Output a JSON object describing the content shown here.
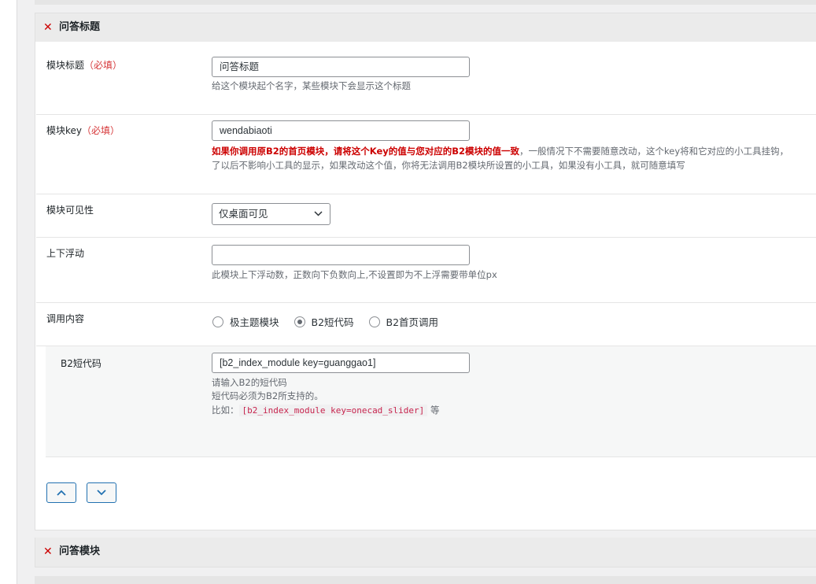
{
  "section1": {
    "title": "问答标题"
  },
  "fields": {
    "module_title": {
      "label": "模块标题",
      "required": "（必填）",
      "value": "问答标题",
      "desc": "给这个模块起个名字，某些模块下会显示这个标题"
    },
    "module_key": {
      "label": "模块key",
      "required": "（必填）",
      "value": "wendabiaoti",
      "desc_warning": "如果你调用原B2的首页模块，请将这个Key的值与您对应的B2模块的值一致",
      "desc_rest": "，一般情况下不需要随意改动，这个key将和它对应的小工具挂钩，",
      "desc_line2": "了以后不影响小工具的显示，如果改动这个值，你将无法调用B2模块所设置的小工具，如果没有小工具，就可随意填写"
    },
    "visibility": {
      "label": "模块可见性",
      "selected": "仅桌面可见"
    },
    "float": {
      "label": "上下浮动",
      "value": "",
      "desc": "此模块上下浮动数，正数向下负数向上,不设置即为不上浮需要带单位px"
    },
    "content": {
      "label": "调用内容",
      "options": [
        "极主题模块",
        "B2短代码",
        "B2首页调用"
      ],
      "selected_index": 1
    },
    "shortcode": {
      "label": "B2短代码",
      "value": "[b2_index_module key=guanggao1]",
      "desc1": "请输入B2的短代码",
      "desc2": "短代码必须为B2所支持的。",
      "example_prefix": "比如：",
      "example_code": "[b2_index_module key=onecad_slider]",
      "example_suffix": "等"
    }
  },
  "controls": {
    "up_icon": "chevron-up-icon",
    "down_icon": "chevron-down-icon"
  },
  "section2": {
    "title": "问答模块"
  },
  "colors": {
    "required": "#d63638",
    "warning": "#cc0000",
    "close": "#cc0000",
    "accent": "#2271b1"
  }
}
